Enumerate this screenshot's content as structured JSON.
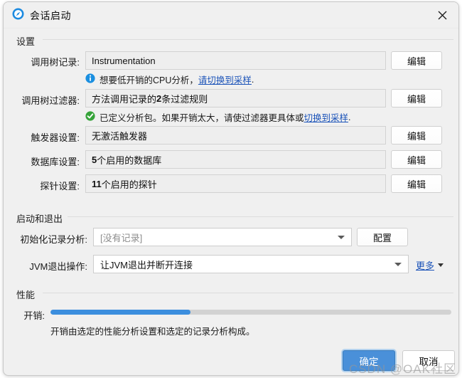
{
  "window": {
    "title": "会话启动",
    "icon": "profiler-circle-icon",
    "close_label": "✕"
  },
  "sections": {
    "settings": {
      "title": "设置"
    },
    "startup_exit": {
      "title": "启动和退出"
    },
    "performance": {
      "title": "性能"
    }
  },
  "settings_rows": [
    {
      "label": "调用树记录:",
      "value": "Instrumentation",
      "button": "编辑"
    },
    {
      "label": "调用树过滤器:",
      "value_prefix": "方法调用记录的",
      "value_bold": "2",
      "value_suffix": "条过滤规则",
      "button": "编辑"
    },
    {
      "label": "触发器设置:",
      "value": "无激活触发器",
      "button": "编辑"
    },
    {
      "label": "数据库设置:",
      "value_bold": "5",
      "value_suffix": "个启用的数据库",
      "button": "编辑"
    },
    {
      "label": "探针设置:",
      "value_bold": "11",
      "value_suffix": "个启用的探针",
      "button": "编辑"
    }
  ],
  "hints": {
    "info": {
      "icon": "info-icon",
      "text": "想要低开销的CPU分析，",
      "link": "请切换到采样",
      "tail": "."
    },
    "ok": {
      "icon": "check-circle-icon",
      "text": "已定义分析包。如果开销太大，请使过滤器更具体或 ",
      "link": "切换到采样",
      "tail": "."
    }
  },
  "startup_rows": {
    "init_record": {
      "label": "初始化记录分析:",
      "value": "[没有记录]",
      "button": "配置"
    },
    "jvm_exit": {
      "label": "JVM退出操作:",
      "value": "让JVM退出并断开连接",
      "more_label": "更多"
    }
  },
  "performance": {
    "overhead_label": "开销:",
    "overhead_percent": 35,
    "note": "开销由选定的性能分析设置和选定的记录分析构成。"
  },
  "footer": {
    "ok": "确定",
    "cancel": "取消"
  },
  "watermark": "CSDN @OAK社区",
  "colors": {
    "accent": "#4a90d9",
    "bar_fill": "#3c8ede",
    "link": "#1a52b8",
    "info": "#1a8fe0",
    "success": "#36a33a",
    "window_bg": "#f0f0f0"
  }
}
